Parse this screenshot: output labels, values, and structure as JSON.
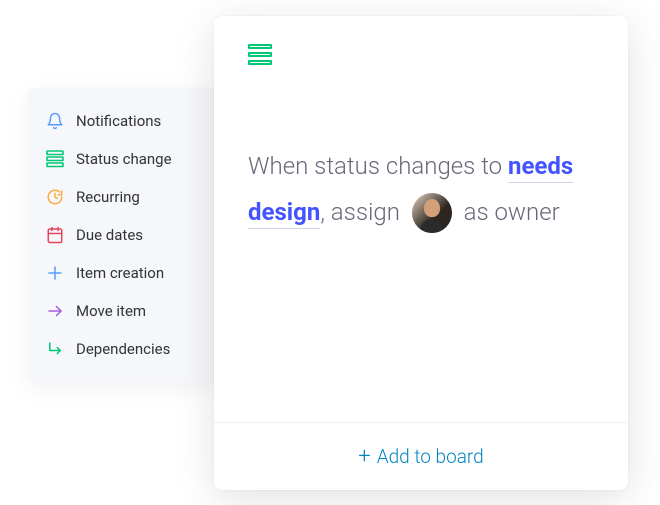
{
  "sidebar": {
    "items": [
      {
        "label": "Notifications",
        "icon": "bell",
        "color": "#579bfc"
      },
      {
        "label": "Status change",
        "icon": "status-bars",
        "color": "#00c875"
      },
      {
        "label": "Recurring",
        "icon": "clock-refresh",
        "color": "#fdab3d"
      },
      {
        "label": "Due dates",
        "icon": "calendar",
        "color": "#e2445c"
      },
      {
        "label": "Item creation",
        "icon": "plus",
        "color": "#579bfc"
      },
      {
        "label": "Move item",
        "icon": "arrow-right",
        "color": "#a25ddc"
      },
      {
        "label": "Dependencies",
        "icon": "dependency",
        "color": "#00c875"
      }
    ]
  },
  "rule": {
    "prefix": "When status changes to ",
    "highlight": "needs design",
    "middle": ", assign ",
    "suffix": " as owner"
  },
  "footer": {
    "add_label": "Add to board"
  },
  "colors": {
    "accent_blue": "#4353ff",
    "link_teal": "#0086c0",
    "green": "#00c875"
  }
}
